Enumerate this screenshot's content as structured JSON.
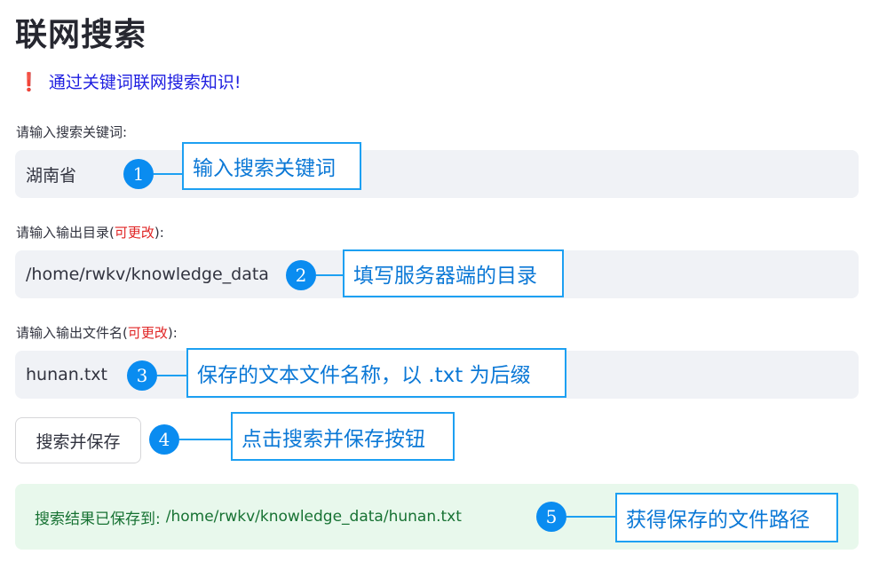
{
  "page": {
    "title": "联网搜索",
    "notice": "通过关键词联网搜索知识!",
    "notice_icon": "❗"
  },
  "form": {
    "keyword_label": "请输入搜索关键词:",
    "keyword_value": "湖南省",
    "dir_label_prefix": "请输入输出目录(",
    "dir_label_em": "可更改",
    "dir_label_suffix": "):",
    "dir_value": "/home/rwkv/knowledge_data",
    "file_label_prefix": "请输入输出文件名(",
    "file_label_em": "可更改",
    "file_label_suffix": "):",
    "file_value": "hunan.txt",
    "submit_label": "搜索并保存"
  },
  "result": {
    "lead": "搜索结果已保存到:",
    "path": "/home/rwkv/knowledge_data/hunan.txt"
  },
  "annotations": [
    {
      "num": "1",
      "text": "输入搜索关键词"
    },
    {
      "num": "2",
      "text": "填写服务器端的目录"
    },
    {
      "num": "3",
      "text": "保存的文本文件名称，以 .txt 为后缀"
    },
    {
      "num": "4",
      "text": "点击搜索并保存按钮"
    },
    {
      "num": "5",
      "text": "获得保存的文件路径"
    }
  ],
  "colors": {
    "accent": "#1da0f2",
    "badge": "#0a8cf0",
    "success_bg": "#e8f8ec",
    "success_text": "#177233",
    "field_bg": "#f0f2f6",
    "notice_text": "#1e1ee0",
    "warn": "#e02424"
  }
}
